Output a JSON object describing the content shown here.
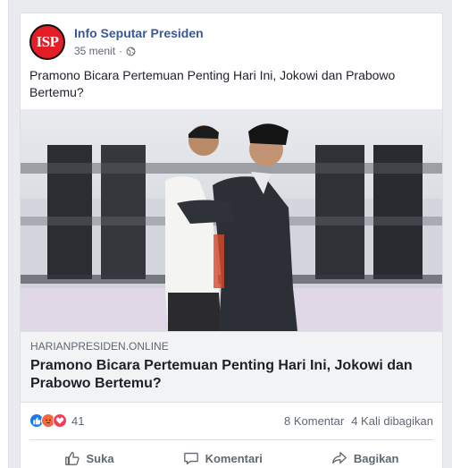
{
  "post": {
    "page_name": "Info Seputar Presiden",
    "avatar_text": "ISP",
    "time": "35 menit",
    "separator": "·",
    "text": "Pramono Bicara Pertemuan Penting Hari Ini, Jokowi dan Prabowo Bertemu?",
    "privacy_icon": "globe-icon"
  },
  "link": {
    "domain": "HARIANPRESIDEN.ONLINE",
    "title": "Pramono Bicara Pertemuan Penting Hari Ini, Jokowi dan Prabowo Bertemu?"
  },
  "reactions": {
    "icons": [
      "like-icon",
      "angry-icon",
      "love-icon"
    ],
    "count": "41",
    "comments": "8 Komentar",
    "shares": "4 Kali dibagikan"
  },
  "actions": {
    "like": "Suka",
    "comment": "Komentari",
    "share": "Bagikan"
  },
  "colors": {
    "link_blue": "#385898",
    "like_blue": "#1877f2",
    "angry_orange": "#f4683c",
    "love_red": "#f33e58",
    "avatar_red": "#e41e26"
  }
}
